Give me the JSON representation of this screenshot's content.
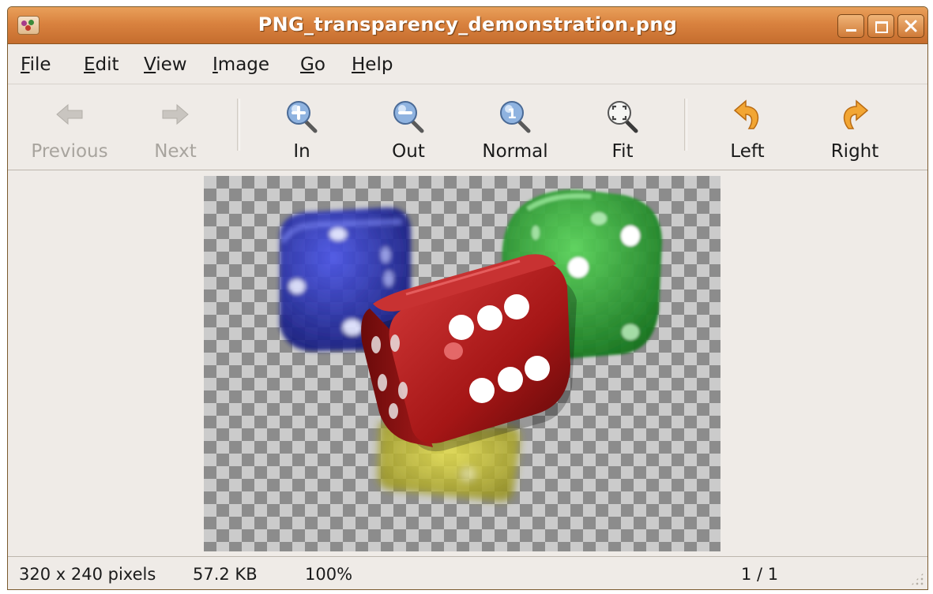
{
  "window": {
    "title": "PNG_transparency_demonstration.png",
    "accent": "#d9823f"
  },
  "menu": {
    "items": [
      {
        "label": "File",
        "mnemonic": "F",
        "rest": "ile"
      },
      {
        "label": "Edit",
        "mnemonic": "E",
        "rest": "dit"
      },
      {
        "label": "View",
        "mnemonic": "V",
        "rest": "iew"
      },
      {
        "label": "Image",
        "mnemonic": "I",
        "rest": "mage"
      },
      {
        "label": "Go",
        "mnemonic": "G",
        "rest": "o"
      },
      {
        "label": "Help",
        "mnemonic": "H",
        "rest": "elp"
      }
    ]
  },
  "toolbar": {
    "previous": {
      "label": "Previous",
      "icon": "arrow-left-icon",
      "enabled": false
    },
    "next": {
      "label": "Next",
      "icon": "arrow-right-icon",
      "enabled": false
    },
    "zoom_in": {
      "label": "In",
      "icon": "zoom-in-icon"
    },
    "zoom_out": {
      "label": "Out",
      "icon": "zoom-out-icon"
    },
    "zoom_normal": {
      "label": "Normal",
      "icon": "zoom-normal-icon"
    },
    "zoom_fit": {
      "label": "Fit",
      "icon": "zoom-fit-icon"
    },
    "rotate_left": {
      "label": "Left",
      "icon": "rotate-left-icon"
    },
    "rotate_right": {
      "label": "Right",
      "icon": "rotate-right-icon"
    }
  },
  "image": {
    "dice": [
      {
        "color": "blue",
        "hex": "#2a2fa8"
      },
      {
        "color": "green",
        "hex": "#2e9a2e"
      },
      {
        "color": "yellow",
        "hex": "#c8c23a"
      },
      {
        "color": "red",
        "hex": "#b21e1e"
      }
    ]
  },
  "status": {
    "dimensions": "320 x 240 pixels",
    "size": "57.2 KB",
    "zoom": "100%",
    "position": "1 / 1"
  }
}
